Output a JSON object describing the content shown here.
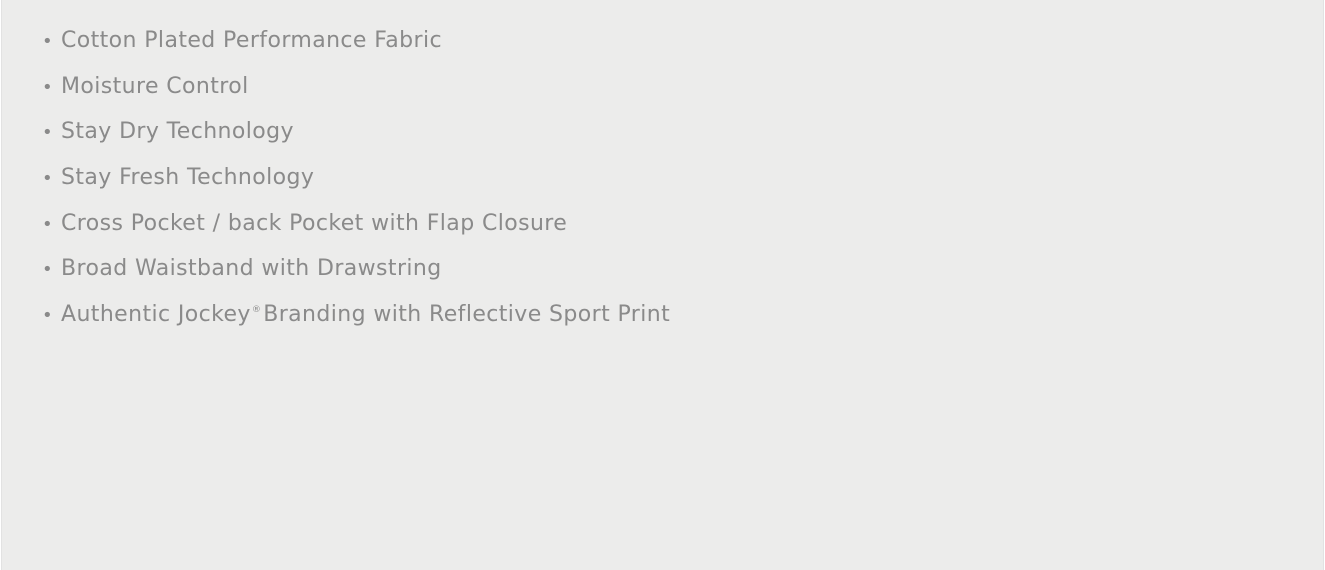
{
  "features": {
    "bullet": "•",
    "items": [
      {
        "label": "Cotton Plated Performance Fabric"
      },
      {
        "label": "Moisture Control"
      },
      {
        "label": "Stay Dry Technology"
      },
      {
        "label": "Stay Fresh Technology"
      },
      {
        "label": "Cross Pocket / back Pocket with Flap Closure"
      },
      {
        "label": "Broad Waistband with Drawstring"
      },
      {
        "label_before": "Authentic Jockey",
        "registered_mark": "®",
        "label_after": "Branding with Reflective Sport Print"
      }
    ]
  },
  "colors": {
    "background": "#ececeb",
    "text": "#8a8a8a"
  }
}
